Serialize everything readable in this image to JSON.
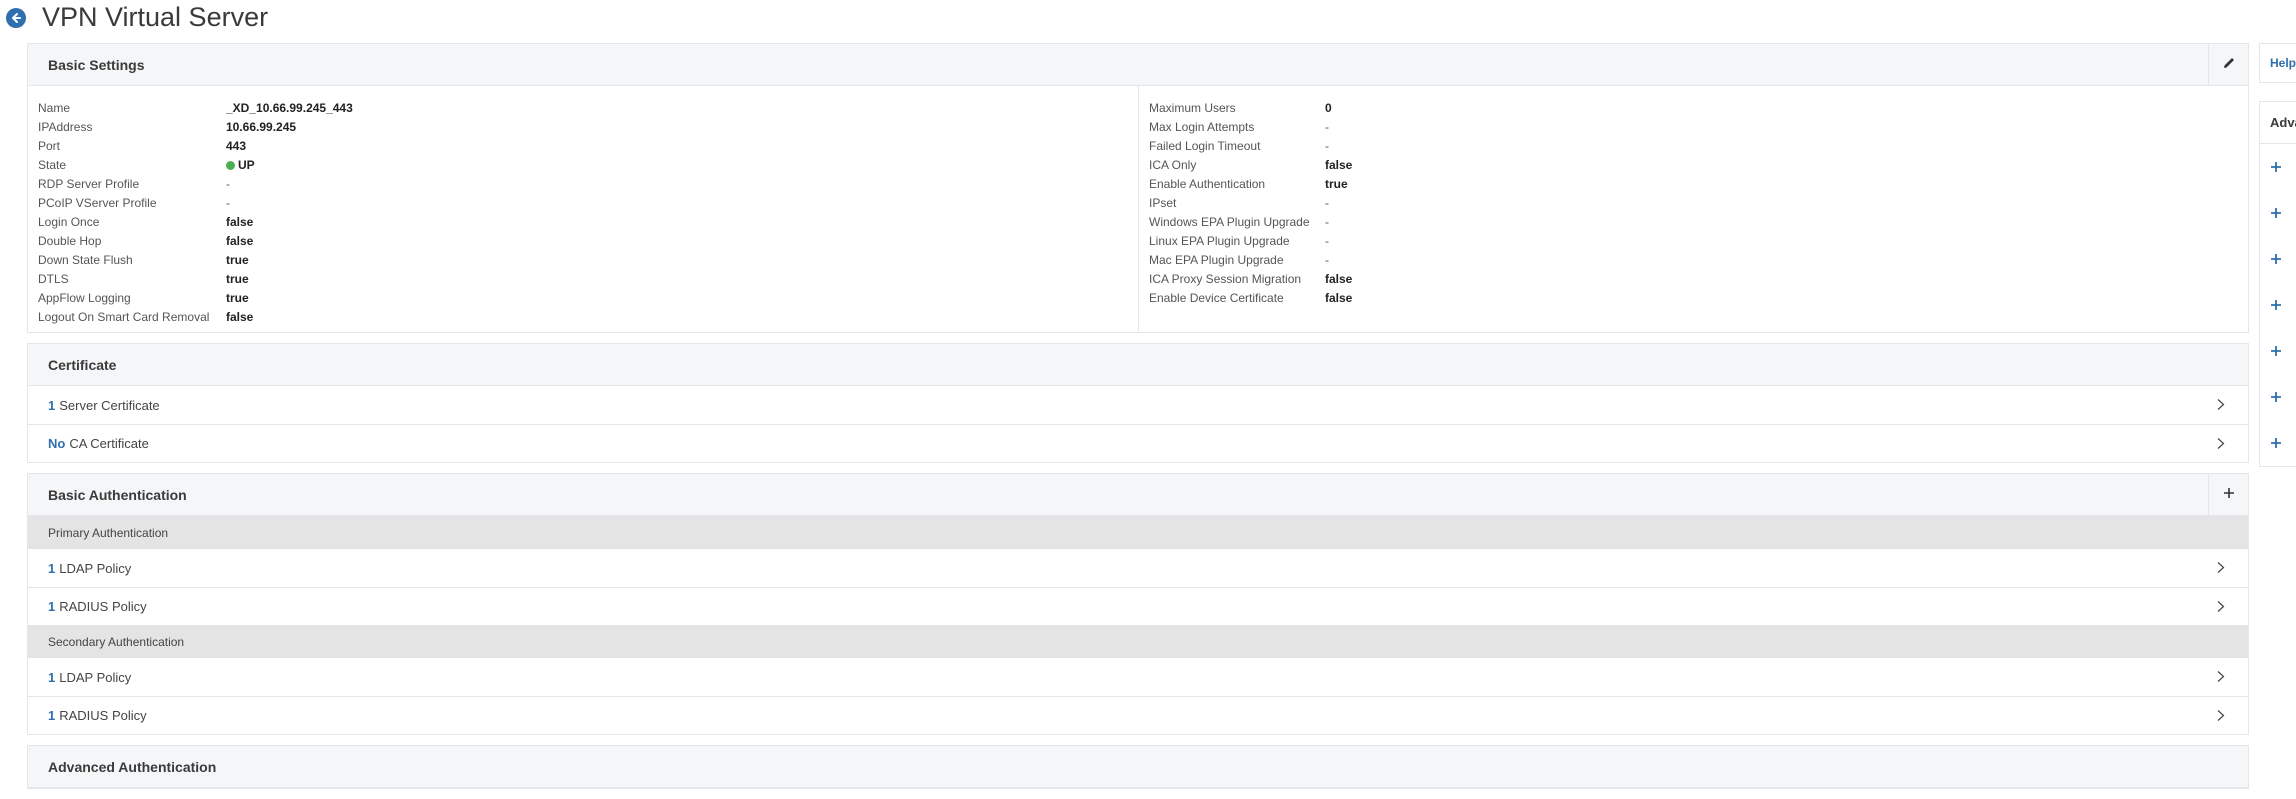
{
  "header": {
    "title": "VPN Virtual Server",
    "back_icon": "back-arrow-icon"
  },
  "basic_settings": {
    "title": "Basic Settings",
    "edit_icon": "pencil-icon",
    "left": [
      {
        "label": "Name",
        "value": "_XD_10.66.99.245_443"
      },
      {
        "label": "IPAddress",
        "value": "10.66.99.245"
      },
      {
        "label": "Port",
        "value": "443"
      },
      {
        "label": "State",
        "value": "UP",
        "status_color": "#4caf50"
      },
      {
        "label": "RDP Server Profile",
        "value": "-"
      },
      {
        "label": "PCoIP VServer Profile",
        "value": "-"
      },
      {
        "label": "Login Once",
        "value": "false"
      },
      {
        "label": "Double Hop",
        "value": "false"
      },
      {
        "label": "Down State Flush",
        "value": "true"
      },
      {
        "label": "DTLS",
        "value": "true"
      },
      {
        "label": "AppFlow Logging",
        "value": "true"
      },
      {
        "label": "Logout On Smart Card Removal",
        "value": "false"
      }
    ],
    "right": [
      {
        "label": "Maximum Users",
        "value": "0"
      },
      {
        "label": "Max Login Attempts",
        "value": "-"
      },
      {
        "label": "Failed Login Timeout",
        "value": "-"
      },
      {
        "label": "ICA Only",
        "value": "false"
      },
      {
        "label": "Enable Authentication",
        "value": "true"
      },
      {
        "label": "IPset",
        "value": "-"
      },
      {
        "label": "Windows EPA Plugin Upgrade",
        "value": "-"
      },
      {
        "label": "Linux EPA Plugin Upgrade",
        "value": "-"
      },
      {
        "label": "Mac EPA Plugin Upgrade",
        "value": "-"
      },
      {
        "label": "ICA Proxy Session Migration",
        "value": "false"
      },
      {
        "label": "Enable Device Certificate",
        "value": "false"
      }
    ]
  },
  "certificate": {
    "title": "Certificate",
    "rows": [
      {
        "count": "1",
        "label": "Server Certificate"
      },
      {
        "count": "No",
        "label": "CA Certificate"
      }
    ]
  },
  "basic_auth": {
    "title": "Basic Authentication",
    "add_icon": "plus-icon",
    "primary_label": "Primary Authentication",
    "primary_rows": [
      {
        "count": "1",
        "label": "LDAP Policy"
      },
      {
        "count": "1",
        "label": "RADIUS Policy"
      }
    ],
    "secondary_label": "Secondary Authentication",
    "secondary_rows": [
      {
        "count": "1",
        "label": "LDAP Policy"
      },
      {
        "count": "1",
        "label": "RADIUS Policy"
      }
    ]
  },
  "advanced_auth": {
    "title": "Advanced Authentication"
  },
  "right_rail": {
    "help_label": "Help",
    "advanced_label": "Adva",
    "plus_count": 7
  },
  "colors": {
    "accent": "#2f6fae",
    "status_up": "#4caf50",
    "subheader_bg": "#e4e4e4"
  }
}
